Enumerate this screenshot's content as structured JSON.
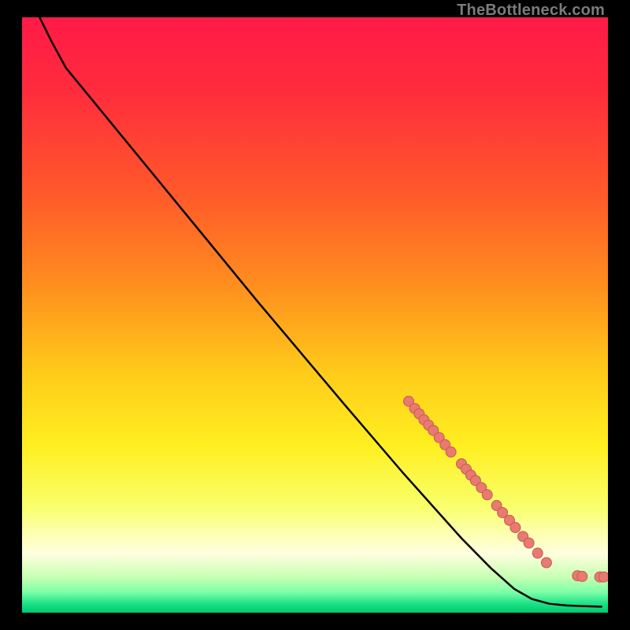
{
  "attribution": "TheBottleneck.com",
  "colors": {
    "gradient_stops": [
      {
        "offset": 0.0,
        "color": "#ff1a47"
      },
      {
        "offset": 0.12,
        "color": "#ff2b3d"
      },
      {
        "offset": 0.3,
        "color": "#ff5a2a"
      },
      {
        "offset": 0.45,
        "color": "#ff8e1e"
      },
      {
        "offset": 0.6,
        "color": "#ffcc1a"
      },
      {
        "offset": 0.72,
        "color": "#ffef20"
      },
      {
        "offset": 0.82,
        "color": "#f9ff6a"
      },
      {
        "offset": 0.9,
        "color": "#ffffe0"
      },
      {
        "offset": 0.94,
        "color": "#c8ffb3"
      },
      {
        "offset": 0.965,
        "color": "#7effa8"
      },
      {
        "offset": 0.985,
        "color": "#1be287"
      },
      {
        "offset": 1.0,
        "color": "#00c86e"
      }
    ],
    "curve": "#000000",
    "marker_fill": "#e87a71",
    "marker_stroke": "#c75a52"
  },
  "chart_data": {
    "type": "line",
    "title": "",
    "xlabel": "",
    "ylabel": "",
    "xlim": [
      0,
      100
    ],
    "ylim": [
      0,
      100
    ],
    "grid": false,
    "curve_points": [
      {
        "x": 3.0,
        "y": 100.0
      },
      {
        "x": 5.0,
        "y": 96.0
      },
      {
        "x": 7.5,
        "y": 91.5
      },
      {
        "x": 10.0,
        "y": 88.5
      },
      {
        "x": 15.0,
        "y": 82.5
      },
      {
        "x": 25.0,
        "y": 70.5
      },
      {
        "x": 40.0,
        "y": 52.5
      },
      {
        "x": 55.0,
        "y": 35.0
      },
      {
        "x": 65.0,
        "y": 23.5
      },
      {
        "x": 70.0,
        "y": 18.0
      },
      {
        "x": 75.0,
        "y": 12.5
      },
      {
        "x": 80.0,
        "y": 7.5
      },
      {
        "x": 84.0,
        "y": 4.0
      },
      {
        "x": 87.0,
        "y": 2.3
      },
      {
        "x": 90.0,
        "y": 1.5
      },
      {
        "x": 93.0,
        "y": 1.2
      },
      {
        "x": 96.0,
        "y": 1.1
      },
      {
        "x": 99.0,
        "y": 1.0
      }
    ],
    "markers": [
      {
        "x": 66.0,
        "y": 35.5
      },
      {
        "x": 67.0,
        "y": 34.3
      },
      {
        "x": 67.8,
        "y": 33.4
      },
      {
        "x": 68.6,
        "y": 32.4
      },
      {
        "x": 69.4,
        "y": 31.5
      },
      {
        "x": 70.2,
        "y": 30.6
      },
      {
        "x": 71.2,
        "y": 29.4
      },
      {
        "x": 72.2,
        "y": 28.2
      },
      {
        "x": 73.2,
        "y": 27.0
      },
      {
        "x": 75.0,
        "y": 25.0
      },
      {
        "x": 75.8,
        "y": 24.1
      },
      {
        "x": 76.6,
        "y": 23.1
      },
      {
        "x": 77.4,
        "y": 22.2
      },
      {
        "x": 78.4,
        "y": 21.0
      },
      {
        "x": 79.4,
        "y": 19.8
      },
      {
        "x": 81.0,
        "y": 18.0
      },
      {
        "x": 82.0,
        "y": 16.8
      },
      {
        "x": 83.2,
        "y": 15.5
      },
      {
        "x": 84.2,
        "y": 14.3
      },
      {
        "x": 85.5,
        "y": 12.8
      },
      {
        "x": 86.5,
        "y": 11.7
      },
      {
        "x": 88.0,
        "y": 10.0
      },
      {
        "x": 89.5,
        "y": 8.4
      },
      {
        "x": 94.8,
        "y": 6.2
      },
      {
        "x": 95.6,
        "y": 6.1
      },
      {
        "x": 98.6,
        "y": 6.0
      },
      {
        "x": 99.3,
        "y": 6.0
      }
    ]
  }
}
